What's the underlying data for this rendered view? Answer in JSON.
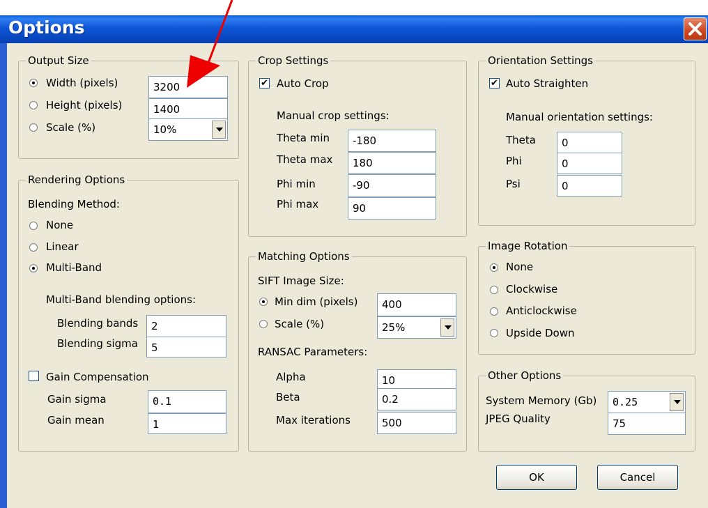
{
  "window": {
    "title": "Options"
  },
  "output_size": {
    "legend": "Output Size",
    "width_label": "Width (pixels)",
    "width_value": "3200",
    "height_label": "Height (pixels)",
    "height_value": "1400",
    "scale_label": "Scale (%)",
    "scale_value": "10%",
    "selected": "width"
  },
  "rendering": {
    "legend": "Rendering Options",
    "method_label": "Blending Method:",
    "none_label": "None",
    "linear_label": "Linear",
    "multiband_label": "Multi-Band",
    "selected": "multiband",
    "multiband_options_label": "Multi-Band blending options:",
    "bands_label": "Blending bands",
    "bands_value": "2",
    "sigma_label": "Blending sigma",
    "sigma_value": "5",
    "gain_comp_label": "Gain Compensation",
    "gain_comp_checked": false,
    "gain_sigma_label": "Gain sigma",
    "gain_sigma_value": "0.1",
    "gain_mean_label": "Gain mean",
    "gain_mean_value": "1"
  },
  "crop": {
    "legend": "Crop Settings",
    "auto_crop_label": "Auto Crop",
    "auto_crop_checked": true,
    "manual_label": "Manual crop settings:",
    "theta_min_label": "Theta min",
    "theta_min_value": "-180",
    "theta_max_label": "Theta max",
    "theta_max_value": "180",
    "phi_min_label": "Phi min",
    "phi_min_value": "-90",
    "phi_max_label": "Phi max",
    "phi_max_value": "90"
  },
  "matching": {
    "legend": "Matching Options",
    "sift_label": "SIFT Image Size:",
    "min_dim_label": "Min dim (pixels)",
    "min_dim_value": "400",
    "scale_label": "Scale (%)",
    "scale_value": "25%",
    "selected": "min_dim",
    "ransac_label": "RANSAC Parameters:",
    "alpha_label": "Alpha",
    "alpha_value": "10",
    "beta_label": "Beta",
    "beta_value": "0.2",
    "max_iter_label": "Max iterations",
    "max_iter_value": "500"
  },
  "orientation": {
    "legend": "Orientation Settings",
    "auto_straighten_label": "Auto Straighten",
    "auto_straighten_checked": true,
    "manual_label": "Manual orientation settings:",
    "theta_label": "Theta",
    "theta_value": "0",
    "phi_label": "Phi",
    "phi_value": "0",
    "psi_label": "Psi",
    "psi_value": "0"
  },
  "rotation": {
    "legend": "Image Rotation",
    "none_label": "None",
    "clockwise_label": "Clockwise",
    "anticlockwise_label": "Anticlockwise",
    "upside_down_label": "Upside Down",
    "selected": "none"
  },
  "other": {
    "legend": "Other Options",
    "memory_label": "System Memory (Gb)",
    "memory_value": "0.25",
    "jpeg_label": "JPEG Quality",
    "jpeg_value": "75"
  },
  "buttons": {
    "ok": "OK",
    "cancel": "Cancel"
  },
  "colors": {
    "titlebar": "#0a55d0",
    "dialog": "#ece9d8",
    "annotation_arrow": "#ee0000"
  },
  "icons": {
    "close": "close-icon",
    "arrow": "annotation-arrow"
  }
}
